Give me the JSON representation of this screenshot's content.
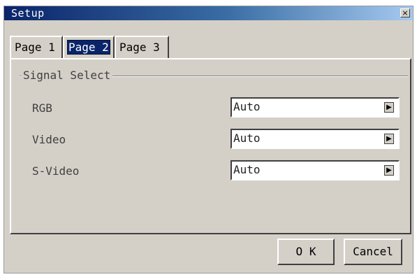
{
  "window": {
    "title": "Setup",
    "close_label": "×"
  },
  "tabs": [
    {
      "label": "Page 1",
      "active": false
    },
    {
      "label": "Page 2",
      "active": true
    },
    {
      "label": "Page 3",
      "active": false
    }
  ],
  "group": {
    "label": "Signal Select"
  },
  "rows": [
    {
      "label": "RGB",
      "value": "Auto"
    },
    {
      "label": "Video",
      "value": "Auto"
    },
    {
      "label": "S-Video",
      "value": "Auto"
    }
  ],
  "buttons": {
    "ok": "O K",
    "cancel": "Cancel"
  }
}
